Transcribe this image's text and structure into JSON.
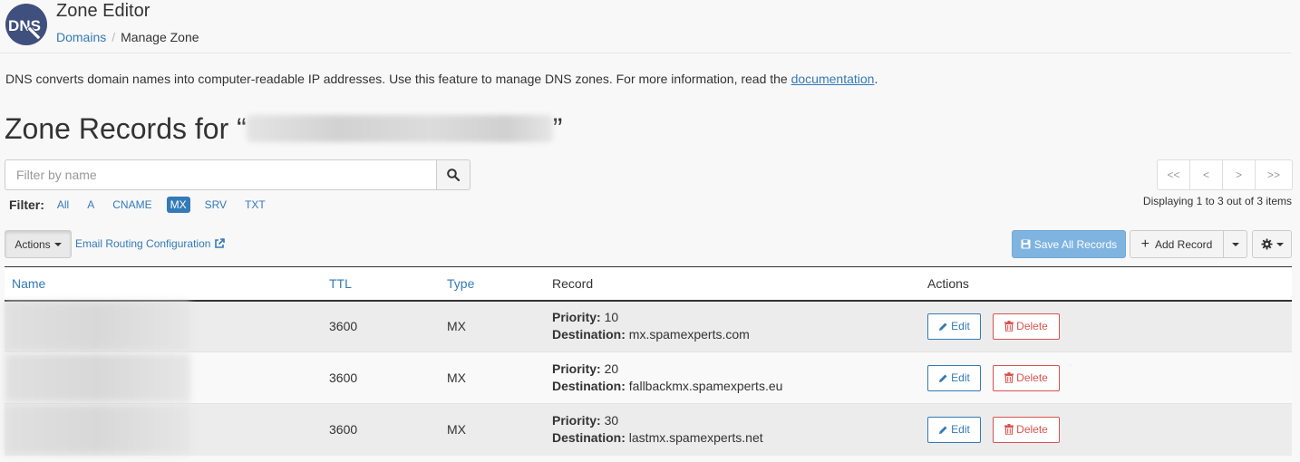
{
  "header": {
    "logo_text": "DNS",
    "title": "Zone Editor",
    "breadcrumb": {
      "parent": "Domains",
      "separator": "/",
      "current": "Manage Zone"
    }
  },
  "intro": {
    "text": "DNS converts domain names into computer-readable IP addresses. Use this feature to manage DNS zones. For more information, read the ",
    "link": "documentation",
    "suffix": "."
  },
  "heading": {
    "prefix": "Zone Records for “",
    "suffix": "”"
  },
  "search": {
    "placeholder": "Filter by name",
    "icon": "search-icon"
  },
  "filter": {
    "label": "Filter:",
    "options": [
      "All",
      "A",
      "CNAME",
      "MX",
      "SRV",
      "TXT"
    ],
    "active": "MX"
  },
  "pager": {
    "first": "<<",
    "prev": "<",
    "next": ">",
    "last": ">>",
    "info": "Displaying 1 to 3 out of 3 items"
  },
  "toolbar": {
    "actions_label": "Actions",
    "email_routing_label": "Email Routing Configuration",
    "save_all_label": "Save All Records",
    "add_record_label": "Add Record",
    "settings_icon": "gear-icon"
  },
  "table": {
    "columns": {
      "name": "Name",
      "ttl": "TTL",
      "type": "Type",
      "record": "Record",
      "actions": "Actions"
    },
    "rows": [
      {
        "ttl": "3600",
        "type": "MX",
        "priority_label": "Priority:",
        "priority": "10",
        "destination_label": "Destination:",
        "destination": "mx.spamexperts.com",
        "edit": "Edit",
        "delete": "Delete"
      },
      {
        "ttl": "3600",
        "type": "MX",
        "priority_label": "Priority:",
        "priority": "20",
        "destination_label": "Destination:",
        "destination": "fallbackmx.spamexperts.eu",
        "edit": "Edit",
        "delete": "Delete"
      },
      {
        "ttl": "3600",
        "type": "MX",
        "priority_label": "Priority:",
        "priority": "30",
        "destination_label": "Destination:",
        "destination": "lastmx.spamexperts.net",
        "edit": "Edit",
        "delete": "Delete"
      }
    ]
  },
  "colors": {
    "link": "#337ab7",
    "active_filter": "#337ab7",
    "save_button": "#7fb3e0",
    "delete": "#d9534f",
    "logo_bg": "#3f4f7e"
  }
}
